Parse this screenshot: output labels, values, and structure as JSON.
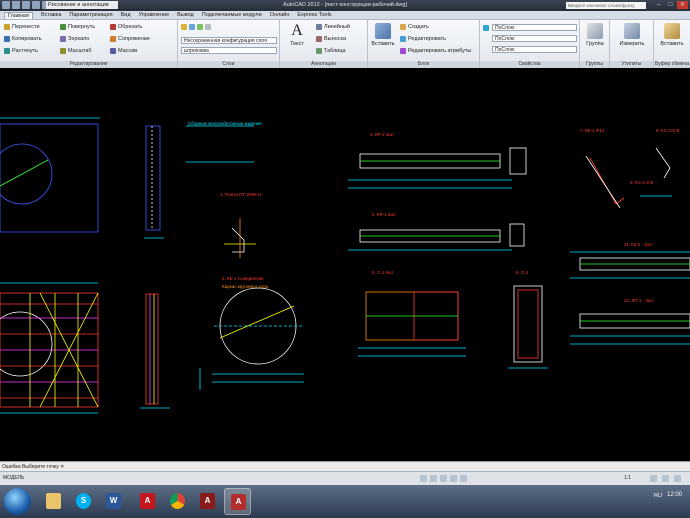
{
  "titlebar": {
    "workspace": "Рисование и аннотации",
    "title": "AutoCAD 2012 - [лист-конструкции-рабочий.dwg]",
    "search_placeholder": "Введите ключевое слово/фразу",
    "colors": {
      "bg": "#2f3742",
      "close": "#c0392b"
    }
  },
  "tabs": [
    "Главная",
    "Вставка",
    "Параметризация",
    "Вид",
    "Управление",
    "Вывод",
    "Подключаемые модули",
    "Онлайн",
    "Express Tools"
  ],
  "ribbon": {
    "modify": {
      "title": "Редактирование",
      "items": [
        "Перенести",
        "Повернуть",
        "Обрезать",
        "Копировать",
        "Зеркало",
        "Сопряжение",
        "Растянуть",
        "Масштаб",
        "Массив"
      ]
    },
    "layers": {
      "title": "Слои",
      "combo_state": "Несохраненная конфигурация слоя",
      "combo_layer": "штриховка"
    },
    "annotation": {
      "title": "Аннотации",
      "text_label": "Текст",
      "items": [
        "Линейный",
        "Выноска",
        "Таблица"
      ]
    },
    "block": {
      "title": "Блок",
      "insert_label": "Вставить",
      "items": [
        "Создать",
        "Редактировать",
        "Редактировать атрибуты"
      ]
    },
    "properties": {
      "title": "Свойства",
      "color": "ПоСлою",
      "linetype": "ПоСлою",
      "lineweight": "ПоСлою"
    },
    "groups": {
      "title": "Группы",
      "label": "Группа"
    },
    "utilities": {
      "title": "Утилиты",
      "label": "Измерить"
    },
    "clipboard": {
      "title": "Буфер обмена",
      "label": "Вставить"
    }
  },
  "drawing": {
    "labels": {
      "slab": "Сборные железобетонные изделия",
      "p1": "1. Плита ПТ-2005-Н",
      "p2": "2. КЕ-1 Соединение",
      "p3": "3. КР-2 3шт",
      "p4": "4. КР-1 3шт",
      "p5": "5. С-1 6шт",
      "p6": "6. С-2",
      "p7": "7. КЕ-1 Ф12",
      "p8": "8. КС-2-8 Ф",
      "p9": "9. КС-2-8 Ф",
      "p11": "11. Кр-2 - 2шт",
      "p12": "12. КП-1 - 3шт",
      "round_note": "Каркас кругового узла"
    },
    "colors": {
      "yellow": "#ffff00",
      "red": "#ff3b2f",
      "cyan": "#00e5ff",
      "green": "#33ff33",
      "white": "#ffffff",
      "magenta": "#ff40ff",
      "blue": "#3d5bff",
      "orange": "#ff8c1a"
    }
  },
  "commandline": {
    "text": "Ошибка  Выберите  точку  ✕"
  },
  "status": {
    "coords": "МОДЕЛЬ",
    "scale": "1:1"
  },
  "taskbar": {
    "apps": [
      "Проводник",
      "Skype",
      "Word",
      "Adobe Reader",
      "Chrome",
      "Adobe Acrobat",
      "AutoCAD"
    ],
    "tray": "RU",
    "clock": "12:00"
  }
}
